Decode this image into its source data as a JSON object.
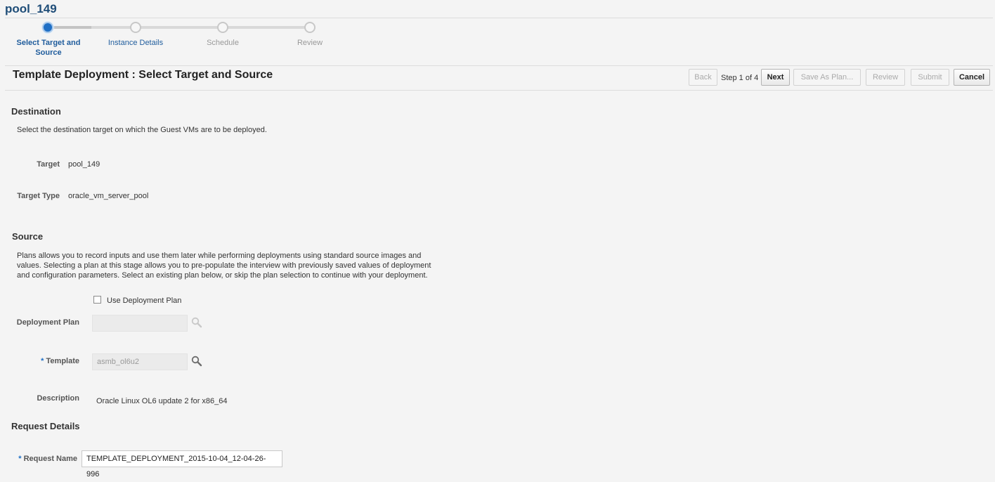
{
  "header": {
    "title": "pool_149"
  },
  "train": {
    "steps": [
      {
        "label": "Select Target and Source",
        "state": "active"
      },
      {
        "label": "Instance Details",
        "state": "link"
      },
      {
        "label": "Schedule",
        "state": "disabled"
      },
      {
        "label": "Review",
        "state": "disabled"
      }
    ]
  },
  "page": {
    "heading": "Template Deployment : Select Target and Source"
  },
  "toolbar": {
    "back": "Back",
    "step_info": "Step 1 of 4",
    "next": "Next",
    "save_plan": "Save As Plan...",
    "review": "Review",
    "submit": "Submit",
    "cancel": "Cancel"
  },
  "destination": {
    "title": "Destination",
    "description": "Select the destination target on which the Guest VMs are to be deployed.",
    "target_label": "Target",
    "target_value": "pool_149",
    "target_type_label": "Target Type",
    "target_type_value": "oracle_vm_server_pool"
  },
  "source": {
    "title": "Source",
    "description_lines": [
      "Plans allows you to record inputs and use them later while performing deployments using standard source images and",
      "values. Selecting a plan at this stage allows you to pre-populate the interview with previously saved values of deployment",
      "and configuration parameters. Select an existing plan below, or skip the plan selection to continue with your deployment."
    ],
    "use_plan_label": "Use Deployment Plan",
    "deployment_plan_label": "Deployment Plan",
    "deployment_plan_value": "",
    "template_label": "Template",
    "template_value": "asmb_ol6u2",
    "description_label": "Description",
    "description_value": "Oracle Linux OL6 update 2 for x86_64"
  },
  "request": {
    "title": "Request Details",
    "name_label": "Request Name",
    "name_value": "TEMPLATE_DEPLOYMENT_2015-10-04_12-04-26-996"
  },
  "required_marker": "*"
}
